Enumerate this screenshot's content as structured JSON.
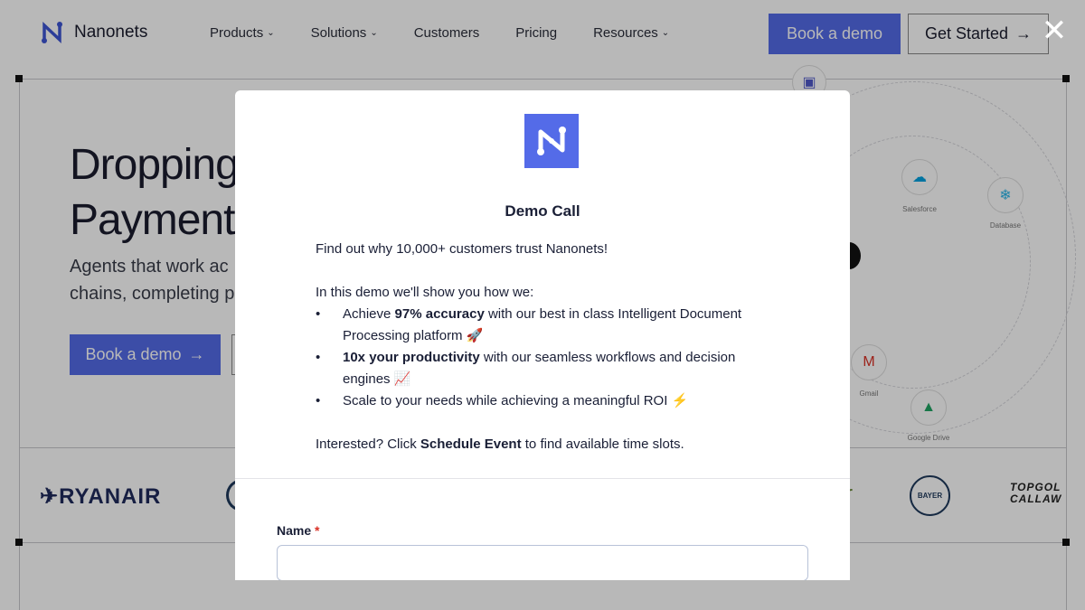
{
  "nav": {
    "logo_text": "Nanonets",
    "links": [
      {
        "label": "Products",
        "dropdown": true
      },
      {
        "label": "Solutions",
        "dropdown": true
      },
      {
        "label": "Customers",
        "dropdown": false
      },
      {
        "label": "Pricing",
        "dropdown": false
      },
      {
        "label": "Resources",
        "dropdown": true
      }
    ],
    "book_demo": "Book a demo",
    "get_started": "Get Started",
    "arrow": "→"
  },
  "hero": {
    "title_line1": "Dropping",
    "title_line2": "Payment",
    "subtitle_line1": "Agents that work ac",
    "subtitle_line2": "chains, completing p",
    "book_demo": "Book a demo",
    "arrow": "→"
  },
  "integrations": [
    {
      "name": "Salesforce",
      "icon": "salesforce-icon"
    },
    {
      "name": "Database",
      "icon": "snowflake-icon"
    },
    {
      "name": "Gmail",
      "icon": "gmail-icon"
    },
    {
      "name": "Google Drive",
      "icon": "google-drive-icon"
    },
    {
      "name": "Teams",
      "icon": "teams-icon"
    }
  ],
  "customer_logos": {
    "ryanair": "RYANAIR",
    "bayer": "BAYER",
    "topgolf_line1": "TOPGOL",
    "topgolf_line2": "CALLAW"
  },
  "modal": {
    "title": "Demo Call",
    "intro": "Find out why 10,000+ customers trust Nanonets!",
    "lead": "In this demo we'll show you how we:",
    "bullets": [
      {
        "prefix": "Achieve ",
        "bold": "97% accuracy",
        "suffix": " with our best in class Intelligent Document Processing platform 🚀"
      },
      {
        "prefix": "",
        "bold": "10x your productivity",
        "suffix": " with our seamless workflows and decision engines 📈"
      },
      {
        "prefix": "Scale to your needs while achieving a meaningful ROI ⚡",
        "bold": "",
        "suffix": ""
      }
    ],
    "cta_prefix": "Interested? Click ",
    "cta_bold": "Schedule Event",
    "cta_suffix": " to find available time slots.",
    "name_label": "Name",
    "required_mark": "*",
    "name_value": ""
  },
  "close_glyph": "✕",
  "colors": {
    "brand": "#546be8",
    "overlay": "rgba(0,0,0,0.28)",
    "text_dark": "#1a1f36"
  }
}
